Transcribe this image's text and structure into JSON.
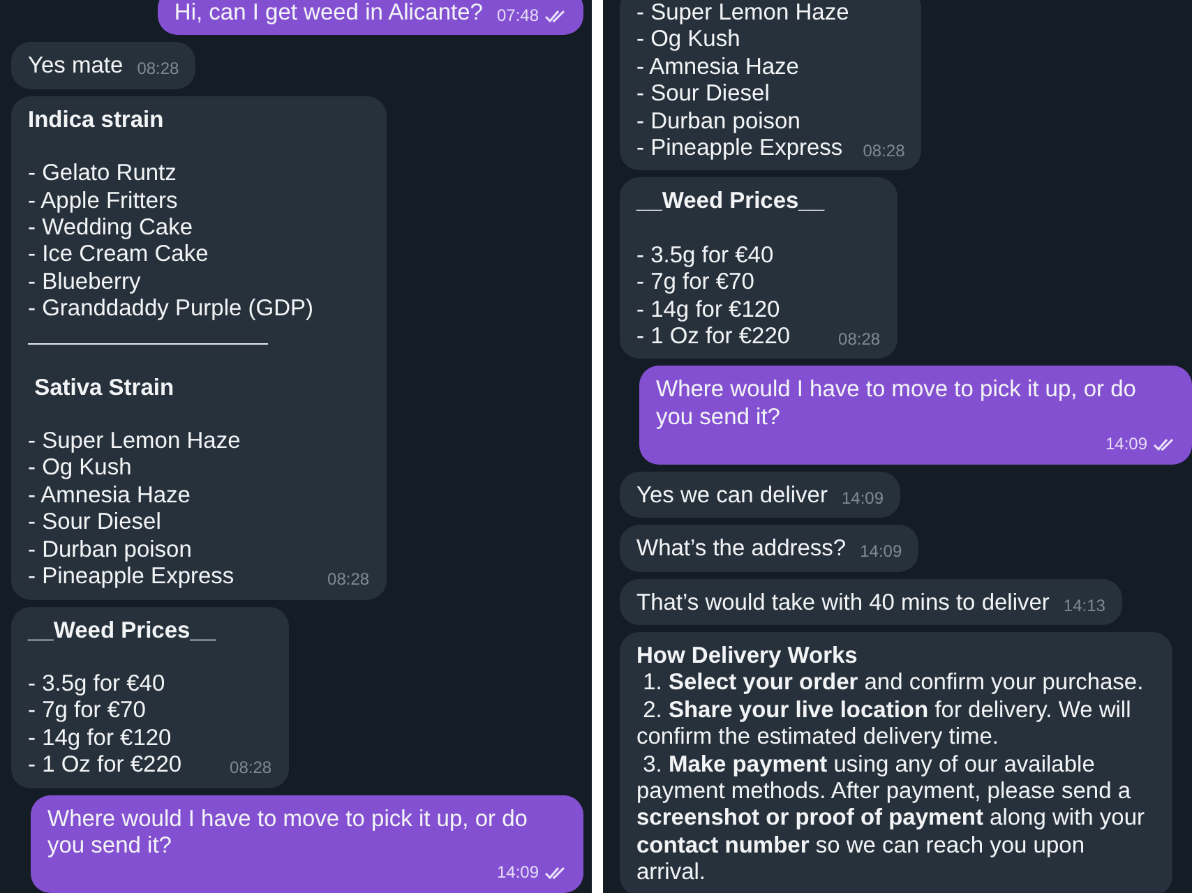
{
  "panels": [
    {
      "messages": [
        {
          "outgoing": true,
          "time": "07:48",
          "read": true,
          "blocks": [
            {
              "kind": "line",
              "text": "Hi, can I get weed in Alicante?"
            }
          ]
        },
        {
          "outgoing": false,
          "time": "08:28",
          "blocks": [
            {
              "kind": "line",
              "text": "Yes mate"
            }
          ]
        },
        {
          "outgoing": false,
          "time": "08:28",
          "blocks": [
            {
              "kind": "heading",
              "text": "Indica strain"
            },
            {
              "kind": "line",
              "text": "- Gelato Runtz"
            },
            {
              "kind": "line",
              "text": "- Apple Fritters"
            },
            {
              "kind": "line",
              "text": "- Wedding Cake"
            },
            {
              "kind": "line",
              "text": "- Ice Cream Cake"
            },
            {
              "kind": "line",
              "text": "- Blueberry"
            },
            {
              "kind": "line",
              "text": "- Granddaddy Purple (GDP)"
            },
            {
              "kind": "rule"
            },
            {
              "kind": "heading",
              "text": " Sativa Strain"
            },
            {
              "kind": "line",
              "text": "- Super Lemon Haze"
            },
            {
              "kind": "line",
              "text": "- Og Kush"
            },
            {
              "kind": "line",
              "text": "- Amnesia Haze"
            },
            {
              "kind": "line",
              "text": "- Sour Diesel"
            },
            {
              "kind": "line",
              "text": "- Durban poison"
            },
            {
              "kind": "line",
              "text": "- Pineapple Express"
            }
          ]
        },
        {
          "outgoing": false,
          "time": "08:28",
          "blocks": [
            {
              "kind": "heading",
              "text": "__Weed Prices__"
            },
            {
              "kind": "line",
              "text": "- 3.5g for €40"
            },
            {
              "kind": "line",
              "text": "- 7g for €70"
            },
            {
              "kind": "line",
              "text": "- 14g for €120"
            },
            {
              "kind": "line",
              "text": "- 1 Oz for €220"
            }
          ]
        },
        {
          "outgoing": true,
          "time": "14:09",
          "read": true,
          "blocks": [
            {
              "kind": "line",
              "text": "Where would I have to move to pick it up, or do you send it?"
            }
          ]
        }
      ]
    },
    {
      "messages": [
        {
          "outgoing": false,
          "time": "08:28",
          "blocks": [
            {
              "kind": "line",
              "text": "- Super Lemon Haze"
            },
            {
              "kind": "line",
              "text": "- Og Kush"
            },
            {
              "kind": "line",
              "text": "- Amnesia Haze"
            },
            {
              "kind": "line",
              "text": "- Sour Diesel"
            },
            {
              "kind": "line",
              "text": "- Durban poison"
            },
            {
              "kind": "line",
              "text": "- Pineapple Express"
            }
          ]
        },
        {
          "outgoing": false,
          "time": "08:28",
          "blocks": [
            {
              "kind": "heading",
              "text": "__Weed Prices__"
            },
            {
              "kind": "line",
              "text": "- 3.5g for €40"
            },
            {
              "kind": "line",
              "text": "- 7g for €70"
            },
            {
              "kind": "line",
              "text": "- 14g for €120"
            },
            {
              "kind": "line",
              "text": "- 1 Oz for €220"
            }
          ]
        },
        {
          "outgoing": true,
          "time": "14:09",
          "read": true,
          "blocks": [
            {
              "kind": "line",
              "text": "Where would I have to move to pick it up, or do you send it?"
            }
          ]
        },
        {
          "outgoing": false,
          "time": "14:09",
          "blocks": [
            {
              "kind": "line",
              "text": "Yes we can deliver"
            }
          ]
        },
        {
          "outgoing": false,
          "time": "14:09",
          "blocks": [
            {
              "kind": "line",
              "text": "What’s the address?"
            }
          ]
        },
        {
          "outgoing": false,
          "time": "14:13",
          "blocks": [
            {
              "kind": "line",
              "text": "That’s would take with 40 mins to deliver"
            }
          ]
        },
        {
          "outgoing": false,
          "blocks": [
            {
              "kind": "title",
              "text": "How Delivery Works"
            },
            {
              "kind": "rich",
              "text": " 1. **Select your order** and confirm your purchase."
            },
            {
              "kind": "rich",
              "text": " 2. **Share your live location** for delivery. We will confirm the estimated delivery time."
            },
            {
              "kind": "rich",
              "text": " 3. **Make payment** using any of our available payment methods. After payment, please send a **screenshot or proof of payment** along with your **contact number** so we can reach you upon arrival."
            }
          ]
        }
      ]
    }
  ]
}
